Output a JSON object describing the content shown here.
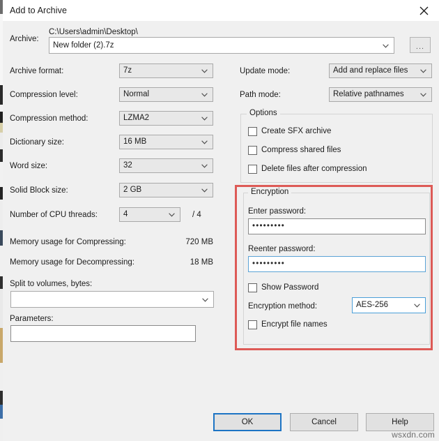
{
  "window": {
    "title": "Add to Archive",
    "close_icon": "close-icon"
  },
  "archive": {
    "label": "Archive:",
    "path_text": "C:\\Users\\admin\\Desktop\\",
    "filename_value": "New folder (2).7z",
    "browse_label": "..."
  },
  "left_column": {
    "archive_format": {
      "label": "Archive format:",
      "value": "7z"
    },
    "compression_level": {
      "label": "Compression level:",
      "value": "Normal"
    },
    "compression_method": {
      "label": "Compression method:",
      "value": "LZMA2"
    },
    "dictionary_size": {
      "label": "Dictionary size:",
      "value": "16 MB"
    },
    "word_size": {
      "label": "Word size:",
      "value": "32"
    },
    "solid_block_size": {
      "label": "Solid Block size:",
      "value": "2 GB"
    },
    "cpu_threads": {
      "label": "Number of CPU threads:",
      "value": "4",
      "total": "/ 4"
    },
    "memory_compressing": {
      "label": "Memory usage for Compressing:",
      "value": "720 MB"
    },
    "memory_decompressing": {
      "label": "Memory usage for Decompressing:",
      "value": "18 MB"
    },
    "split_volumes": {
      "label": "Split to volumes, bytes:",
      "value": ""
    },
    "parameters": {
      "label": "Parameters:",
      "value": ""
    }
  },
  "right_column": {
    "update_mode": {
      "label": "Update mode:",
      "value": "Add and replace files"
    },
    "path_mode": {
      "label": "Path mode:",
      "value": "Relative pathnames"
    },
    "options": {
      "title": "Options",
      "items": [
        {
          "label": "Create SFX archive",
          "checked": false
        },
        {
          "label": "Compress shared files",
          "checked": false
        },
        {
          "label": "Delete files after compression",
          "checked": false
        }
      ]
    },
    "encryption": {
      "title": "Encryption",
      "enter_password_label": "Enter password:",
      "enter_password_value": "•••••••••",
      "reenter_password_label": "Reenter password:",
      "reenter_password_value": "•••••••••",
      "show_password": {
        "label": "Show Password",
        "checked": false
      },
      "encryption_method_label": "Encryption method:",
      "encryption_method_value": "AES-256",
      "encrypt_file_names": {
        "label": "Encrypt file names",
        "checked": false
      }
    }
  },
  "footer": {
    "ok": "OK",
    "cancel": "Cancel",
    "help": "Help"
  },
  "watermark": "wsxdn.com",
  "colors": {
    "highlight_red": "#dd5a56",
    "focus_blue": "#5ba3d6",
    "default_button_blue": "#1d74c4",
    "dialog_bg": "#f0f0f0"
  }
}
